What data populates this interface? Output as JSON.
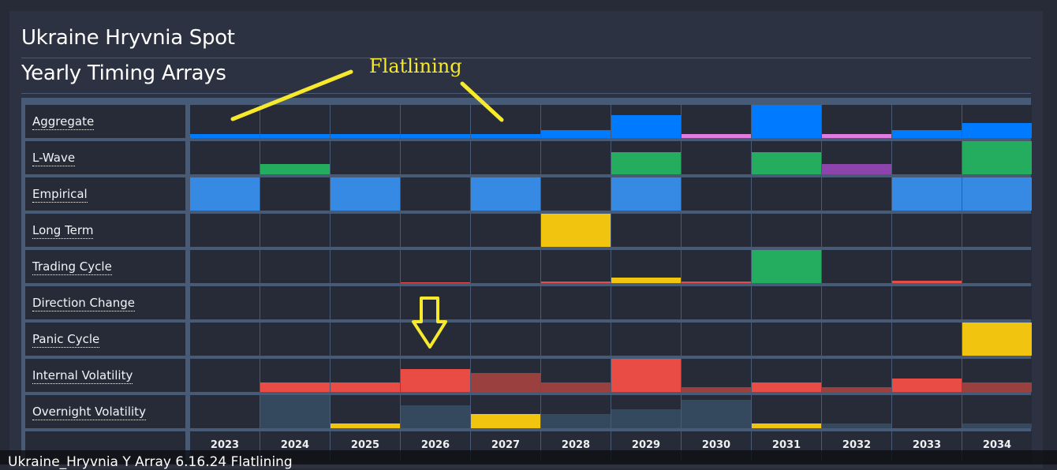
{
  "page": {
    "title": "Ukraine Hryvnia Spot",
    "subtitle": "Yearly Timing Arrays",
    "caption": "Ukraine_Hryvnia Y Array 6.16.24 Flatlining"
  },
  "annotations": {
    "text": "Flatlining",
    "color": "#f7e92b",
    "arrow_target_year": "2026",
    "arrow_target_row": "Internal Volatility"
  },
  "colors": {
    "aggregate": "#007bff",
    "pink": "#e07be0",
    "green": "#24ad5e",
    "purple": "#8e44ad",
    "empirical": "#368ae4",
    "yellow": "#f1c40f",
    "red": "#e84c45",
    "dark_red": "#9a4140",
    "slate": "#34495e"
  },
  "chart_data": {
    "type": "heatmap",
    "title": "Yearly Timing Arrays",
    "x": [
      "2023",
      "2024",
      "2025",
      "2026",
      "2027",
      "2028",
      "2029",
      "2030",
      "2031",
      "2032",
      "2033",
      "2034"
    ],
    "value_units": "fraction of cell height",
    "rows": [
      {
        "name": "Aggregate",
        "values": [
          0.12,
          0.12,
          0.12,
          0.12,
          0.12,
          0.24,
          0.68,
          0.12,
          1.0,
          0.12,
          0.24,
          0.46
        ],
        "colors": [
          "aggregate",
          "aggregate",
          "aggregate",
          "aggregate",
          "aggregate",
          "aggregate",
          "aggregate",
          "pink",
          "aggregate",
          "pink",
          "aggregate",
          "aggregate"
        ]
      },
      {
        "name": "L-Wave",
        "values": [
          0,
          0.3,
          0,
          0,
          0,
          0,
          0.66,
          0,
          0.66,
          0.3,
          0,
          1.0
        ],
        "colors": [
          "green",
          "green",
          "green",
          "green",
          "green",
          "green",
          "green",
          "green",
          "green",
          "purple",
          "green",
          "green"
        ]
      },
      {
        "name": "Empirical",
        "values": [
          1,
          0,
          1,
          0,
          1,
          0,
          1,
          0,
          0,
          0,
          1,
          1
        ],
        "colors": [
          "empirical",
          "empirical",
          "empirical",
          "empirical",
          "empirical",
          "empirical",
          "empirical",
          "empirical",
          "empirical",
          "empirical",
          "empirical",
          "empirical"
        ]
      },
      {
        "name": "Long Term",
        "values": [
          0,
          0,
          0,
          0,
          0,
          1,
          0,
          0,
          0,
          0,
          0,
          0
        ],
        "colors": [
          "yellow",
          "yellow",
          "yellow",
          "yellow",
          "yellow",
          "yellow",
          "yellow",
          "yellow",
          "yellow",
          "yellow",
          "yellow",
          "yellow"
        ]
      },
      {
        "name": "Trading Cycle",
        "values": [
          0,
          0,
          0,
          0.03,
          0,
          0.05,
          0.17,
          0.05,
          1.0,
          0,
          0.07,
          0
        ],
        "colors": [
          "red",
          "red",
          "red",
          "red",
          "red",
          "red",
          "yellow",
          "red",
          "green",
          "red",
          "red",
          "red"
        ]
      },
      {
        "name": "Direction Change",
        "values": [
          0,
          0,
          0,
          0,
          0,
          0,
          0,
          0,
          0,
          0,
          0,
          0
        ],
        "colors": [
          "red",
          "red",
          "red",
          "red",
          "red",
          "red",
          "red",
          "red",
          "red",
          "red",
          "red",
          "red"
        ]
      },
      {
        "name": "Panic Cycle",
        "values": [
          0,
          0,
          0,
          0,
          0,
          0,
          0,
          0,
          0,
          0,
          0,
          1.0
        ],
        "colors": [
          "yellow",
          "yellow",
          "yellow",
          "yellow",
          "yellow",
          "yellow",
          "yellow",
          "yellow",
          "yellow",
          "yellow",
          "yellow",
          "yellow"
        ]
      },
      {
        "name": "Internal Volatility",
        "values": [
          0,
          0.29,
          0.29,
          0.7,
          0.56,
          0.29,
          1.0,
          0.15,
          0.29,
          0.15,
          0.41,
          0.29
        ],
        "colors": [
          "red",
          "red",
          "red",
          "red",
          "dark_red",
          "dark_red",
          "red",
          "dark_red",
          "red",
          "dark_red",
          "red",
          "dark_red"
        ]
      },
      {
        "name": "Overnight Volatility",
        "values": [
          0,
          1.0,
          0.15,
          0.7,
          0.44,
          0.44,
          0.56,
          0.85,
          0.15,
          0.15,
          0,
          0.15
        ],
        "colors": [
          "slate",
          "slate",
          "yellow",
          "slate",
          "yellow",
          "slate",
          "slate",
          "slate",
          "yellow",
          "slate",
          "slate",
          "slate"
        ]
      }
    ]
  }
}
